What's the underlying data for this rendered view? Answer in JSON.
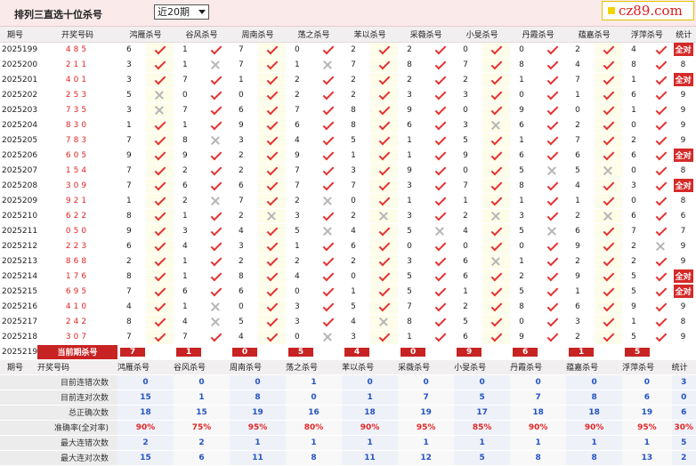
{
  "header": {
    "title": "排列三直选十位杀号",
    "period_select": "近20期",
    "logo_text": "cz89.com"
  },
  "columns": [
    "期号",
    "开奖号码",
    "鸿雁杀号",
    "谷风杀号",
    "周南杀号",
    "荡之杀号",
    "苯以杀号",
    "采薇杀号",
    "小旻杀号",
    "丹霞杀号",
    "蕴嘉杀号",
    "浮萍杀号",
    "统计"
  ],
  "rows": [
    {
      "p": "2025199",
      "w": "485",
      "k": [
        [
          "6",
          1
        ],
        [
          "1",
          1
        ],
        [
          "7",
          1
        ],
        [
          "0",
          1
        ],
        [
          "2",
          1
        ],
        [
          "2",
          1
        ],
        [
          "0",
          1
        ],
        [
          "0",
          1
        ],
        [
          "2",
          1
        ],
        [
          "4",
          1
        ]
      ],
      "s": "全对"
    },
    {
      "p": "2025200",
      "w": "211",
      "k": [
        [
          "3",
          1
        ],
        [
          "1",
          0
        ],
        [
          "7",
          1
        ],
        [
          "1",
          0
        ],
        [
          "7",
          1
        ],
        [
          "8",
          1
        ],
        [
          "7",
          1
        ],
        [
          "8",
          1
        ],
        [
          "4",
          1
        ],
        [
          "8",
          1
        ]
      ],
      "s": "8"
    },
    {
      "p": "2025201",
      "w": "401",
      "k": [
        [
          "3",
          1
        ],
        [
          "7",
          1
        ],
        [
          "1",
          1
        ],
        [
          "2",
          1
        ],
        [
          "2",
          1
        ],
        [
          "2",
          1
        ],
        [
          "2",
          1
        ],
        [
          "1",
          1
        ],
        [
          "7",
          1
        ],
        [
          "1",
          1
        ]
      ],
      "s": "全对"
    },
    {
      "p": "2025202",
      "w": "253",
      "k": [
        [
          "5",
          0
        ],
        [
          "0",
          1
        ],
        [
          "0",
          1
        ],
        [
          "2",
          1
        ],
        [
          "2",
          1
        ],
        [
          "3",
          1
        ],
        [
          "3",
          1
        ],
        [
          "0",
          1
        ],
        [
          "1",
          1
        ],
        [
          "6",
          1
        ]
      ],
      "s": "9"
    },
    {
      "p": "2025203",
      "w": "735",
      "k": [
        [
          "3",
          0
        ],
        [
          "7",
          1
        ],
        [
          "6",
          1
        ],
        [
          "7",
          1
        ],
        [
          "8",
          1
        ],
        [
          "9",
          1
        ],
        [
          "0",
          1
        ],
        [
          "9",
          1
        ],
        [
          "0",
          1
        ],
        [
          "1",
          1
        ]
      ],
      "s": "9"
    },
    {
      "p": "2025204",
      "w": "830",
      "k": [
        [
          "1",
          1
        ],
        [
          "1",
          1
        ],
        [
          "9",
          1
        ],
        [
          "6",
          1
        ],
        [
          "8",
          1
        ],
        [
          "6",
          1
        ],
        [
          "3",
          0
        ],
        [
          "6",
          1
        ],
        [
          "2",
          1
        ],
        [
          "0",
          1
        ]
      ],
      "s": "9"
    },
    {
      "p": "2025205",
      "w": "783",
      "k": [
        [
          "7",
          1
        ],
        [
          "8",
          0
        ],
        [
          "3",
          1
        ],
        [
          "4",
          1
        ],
        [
          "5",
          1
        ],
        [
          "1",
          1
        ],
        [
          "5",
          1
        ],
        [
          "1",
          1
        ],
        [
          "7",
          1
        ],
        [
          "2",
          1
        ]
      ],
      "s": "9"
    },
    {
      "p": "2025206",
      "w": "605",
      "k": [
        [
          "9",
          1
        ],
        [
          "9",
          1
        ],
        [
          "2",
          1
        ],
        [
          "9",
          1
        ],
        [
          "1",
          1
        ],
        [
          "1",
          1
        ],
        [
          "9",
          1
        ],
        [
          "6",
          1
        ],
        [
          "6",
          1
        ],
        [
          "6",
          1
        ]
      ],
      "s": "全对"
    },
    {
      "p": "2025207",
      "w": "154",
      "k": [
        [
          "7",
          1
        ],
        [
          "2",
          1
        ],
        [
          "2",
          1
        ],
        [
          "7",
          1
        ],
        [
          "3",
          1
        ],
        [
          "9",
          1
        ],
        [
          "0",
          1
        ],
        [
          "5",
          0
        ],
        [
          "5",
          0
        ],
        [
          "0",
          1
        ]
      ],
      "s": "8"
    },
    {
      "p": "2025208",
      "w": "309",
      "k": [
        [
          "7",
          1
        ],
        [
          "6",
          1
        ],
        [
          "6",
          1
        ],
        [
          "7",
          1
        ],
        [
          "7",
          1
        ],
        [
          "3",
          1
        ],
        [
          "7",
          1
        ],
        [
          "8",
          1
        ],
        [
          "4",
          1
        ],
        [
          "3",
          1
        ]
      ],
      "s": "全对"
    },
    {
      "p": "2025209",
      "w": "921",
      "k": [
        [
          "1",
          1
        ],
        [
          "2",
          0
        ],
        [
          "7",
          1
        ],
        [
          "2",
          0
        ],
        [
          "0",
          1
        ],
        [
          "1",
          1
        ],
        [
          "1",
          1
        ],
        [
          "1",
          1
        ],
        [
          "1",
          1
        ],
        [
          "0",
          1
        ]
      ],
      "s": "8"
    },
    {
      "p": "2025210",
      "w": "622",
      "k": [
        [
          "8",
          1
        ],
        [
          "1",
          1
        ],
        [
          "2",
          0
        ],
        [
          "3",
          1
        ],
        [
          "2",
          0
        ],
        [
          "3",
          1
        ],
        [
          "2",
          0
        ],
        [
          "3",
          1
        ],
        [
          "2",
          0
        ],
        [
          "6",
          1
        ]
      ],
      "s": "6"
    },
    {
      "p": "2025211",
      "w": "050",
      "k": [
        [
          "9",
          1
        ],
        [
          "3",
          1
        ],
        [
          "4",
          1
        ],
        [
          "5",
          0
        ],
        [
          "4",
          1
        ],
        [
          "5",
          0
        ],
        [
          "4",
          1
        ],
        [
          "5",
          0
        ],
        [
          "6",
          1
        ],
        [
          "7",
          1
        ]
      ],
      "s": "7"
    },
    {
      "p": "2025212",
      "w": "223",
      "k": [
        [
          "6",
          1
        ],
        [
          "4",
          1
        ],
        [
          "3",
          1
        ],
        [
          "1",
          1
        ],
        [
          "6",
          1
        ],
        [
          "0",
          1
        ],
        [
          "0",
          1
        ],
        [
          "0",
          1
        ],
        [
          "9",
          1
        ],
        [
          "2",
          0
        ]
      ],
      "s": "9"
    },
    {
      "p": "2025213",
      "w": "868",
      "k": [
        [
          "2",
          1
        ],
        [
          "1",
          1
        ],
        [
          "2",
          1
        ],
        [
          "2",
          1
        ],
        [
          "2",
          1
        ],
        [
          "3",
          1
        ],
        [
          "6",
          0
        ],
        [
          "1",
          1
        ],
        [
          "2",
          1
        ],
        [
          "2",
          1
        ]
      ],
      "s": "9"
    },
    {
      "p": "2025214",
      "w": "176",
      "k": [
        [
          "8",
          1
        ],
        [
          "1",
          1
        ],
        [
          "8",
          1
        ],
        [
          "4",
          1
        ],
        [
          "0",
          1
        ],
        [
          "5",
          1
        ],
        [
          "6",
          1
        ],
        [
          "2",
          1
        ],
        [
          "9",
          1
        ],
        [
          "5",
          1
        ]
      ],
      "s": "全对"
    },
    {
      "p": "2025215",
      "w": "695",
      "k": [
        [
          "7",
          1
        ],
        [
          "6",
          1
        ],
        [
          "6",
          1
        ],
        [
          "0",
          1
        ],
        [
          "1",
          1
        ],
        [
          "5",
          1
        ],
        [
          "1",
          1
        ],
        [
          "5",
          1
        ],
        [
          "1",
          1
        ],
        [
          "5",
          1
        ]
      ],
      "s": "全对"
    },
    {
      "p": "2025216",
      "w": "410",
      "k": [
        [
          "4",
          1
        ],
        [
          "1",
          0
        ],
        [
          "0",
          1
        ],
        [
          "3",
          1
        ],
        [
          "5",
          1
        ],
        [
          "7",
          1
        ],
        [
          "2",
          1
        ],
        [
          "8",
          1
        ],
        [
          "6",
          1
        ],
        [
          "9",
          1
        ]
      ],
      "s": "9"
    },
    {
      "p": "2025217",
      "w": "242",
      "k": [
        [
          "8",
          1
        ],
        [
          "4",
          0
        ],
        [
          "5",
          1
        ],
        [
          "3",
          1
        ],
        [
          "4",
          0
        ],
        [
          "8",
          1
        ],
        [
          "5",
          1
        ],
        [
          "0",
          1
        ],
        [
          "3",
          1
        ],
        [
          "1",
          1
        ]
      ],
      "s": "8"
    },
    {
      "p": "2025218",
      "w": "307",
      "k": [
        [
          "7",
          1
        ],
        [
          "7",
          1
        ],
        [
          "4",
          1
        ],
        [
          "0",
          0
        ],
        [
          "3",
          1
        ],
        [
          "1",
          1
        ],
        [
          "6",
          1
        ],
        [
          "9",
          1
        ],
        [
          "2",
          1
        ],
        [
          "5",
          1
        ]
      ],
      "s": "9"
    }
  ],
  "current": {
    "p": "2025219",
    "label": "当前期杀号",
    "vals": [
      "7",
      "1",
      "0",
      "5",
      "4",
      "0",
      "9",
      "6",
      "1",
      "5"
    ]
  },
  "stats": [
    {
      "label": "目前连错次数",
      "vals": [
        "0",
        "0",
        "0",
        "1",
        "0",
        "0",
        "0",
        "0",
        "0",
        "0",
        "3"
      ]
    },
    {
      "label": "目前连对次数",
      "vals": [
        "15",
        "1",
        "8",
        "0",
        "1",
        "7",
        "5",
        "7",
        "8",
        "6",
        "0"
      ]
    },
    {
      "label": "总正确次数",
      "vals": [
        "18",
        "15",
        "19",
        "16",
        "18",
        "19",
        "17",
        "18",
        "18",
        "19",
        "6"
      ]
    },
    {
      "label": "准确率(全对率)",
      "vals": [
        "90%",
        "75%",
        "95%",
        "80%",
        "90%",
        "95%",
        "85%",
        "90%",
        "90%",
        "95%",
        "30%"
      ],
      "red": true
    },
    {
      "label": "最大连错次数",
      "vals": [
        "2",
        "2",
        "1",
        "1",
        "1",
        "1",
        "1",
        "1",
        "1",
        "1",
        "5"
      ]
    },
    {
      "label": "最大连对次数",
      "vals": [
        "15",
        "6",
        "11",
        "8",
        "11",
        "12",
        "5",
        "8",
        "8",
        "13",
        "2"
      ]
    }
  ]
}
